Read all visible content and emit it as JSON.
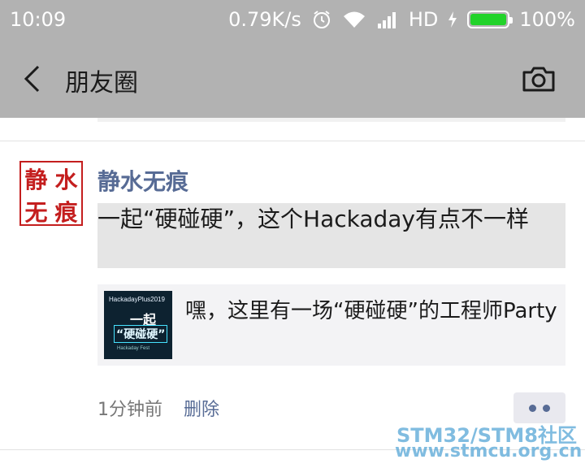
{
  "status_bar": {
    "time": "10:09",
    "network_speed": "0.79K/s",
    "network_type": "HD",
    "battery": "100%",
    "battery_level": 1.0
  },
  "navbar": {
    "title": "朋友圈"
  },
  "post": {
    "author": "静水无痕",
    "avatar_chars": [
      "静",
      "水",
      "无",
      "痕"
    ],
    "text": "一起“硬碰硬”，这个Hackaday有点不一样",
    "link": {
      "title": "嘿，这里有一场“硬碰硬”的工程师Party",
      "thumb_texts": [
        "HackadayPlus2019",
        "一起",
        "“硬碰硬”",
        "Hackaday Fest"
      ]
    },
    "time": "1分钟前",
    "delete_label": "删除"
  },
  "watermark": {
    "line1": "STM32/STM8社区",
    "line2": "www.stmcu.org.cn"
  },
  "colors": {
    "top_bar": "#b2b2b2",
    "name_blue": "#576b95",
    "battery_green": "#22d32a",
    "avatar_red": "#c41e1e"
  }
}
